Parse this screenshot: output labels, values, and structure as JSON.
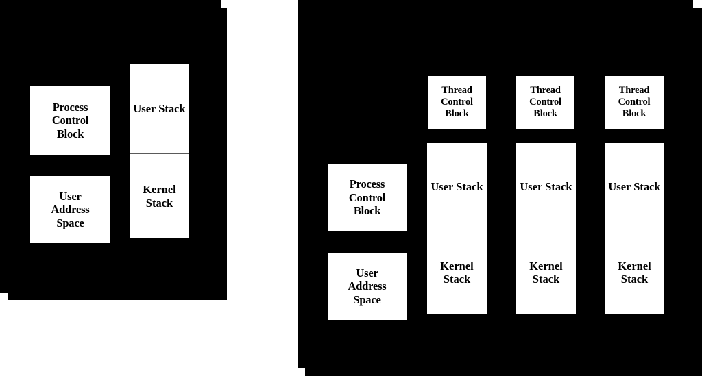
{
  "figure": {
    "background_color": "#ffffff",
    "panel_color": "#000000",
    "box_color": "#ffffff",
    "text_color": "#000000",
    "divider_color": "#5a5a5a"
  },
  "panels": [
    {
      "id": "single-threaded-process-model",
      "boxes": {
        "process_control_block": {
          "line1": "Process",
          "line2": "Control",
          "line3": "Block"
        },
        "user_address_space": {
          "line1": "User",
          "line2": "Address",
          "line3": "Space"
        },
        "user_stack": {
          "line1": "User",
          "line2": "Stack"
        },
        "kernel_stack": {
          "line1": "Kernel",
          "line2": "Stack"
        }
      }
    },
    {
      "id": "multithreaded-process-model",
      "boxes": {
        "process_control_block": {
          "line1": "Process",
          "line2": "Control",
          "line3": "Block"
        },
        "user_address_space": {
          "line1": "User",
          "line2": "Address",
          "line3": "Space"
        }
      },
      "threads": [
        {
          "thread_control_block": {
            "line1": "Thread",
            "line2": "Control",
            "line3": "Block"
          },
          "user_stack": {
            "line1": "User",
            "line2": "Stack"
          },
          "kernel_stack": {
            "line1": "Kernel",
            "line2": "Stack"
          }
        },
        {
          "thread_control_block": {
            "line1": "Thread",
            "line2": "Control",
            "line3": "Block"
          },
          "user_stack": {
            "line1": "User",
            "line2": "Stack"
          },
          "kernel_stack": {
            "line1": "Kernel",
            "line2": "Stack"
          }
        },
        {
          "thread_control_block": {
            "line1": "Thread",
            "line2": "Control",
            "line3": "Block"
          },
          "user_stack": {
            "line1": "User",
            "line2": "Stack"
          },
          "kernel_stack": {
            "line1": "Kernel",
            "line2": "Stack"
          }
        }
      ]
    }
  ]
}
